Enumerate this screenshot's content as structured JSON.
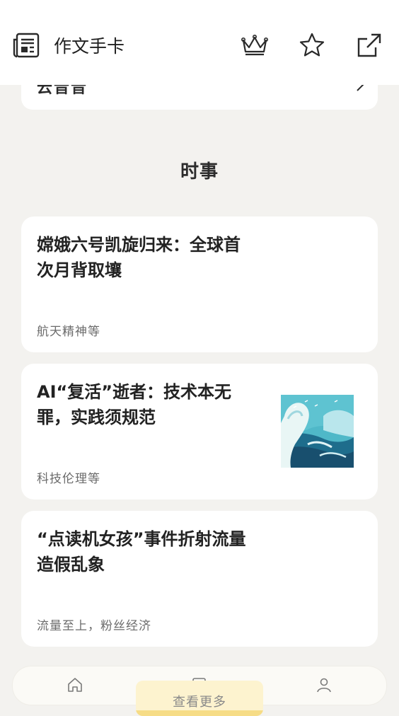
{
  "header": {
    "title": "作文手卡",
    "actions": [
      {
        "icon": "crown-icon"
      },
      {
        "icon": "star-icon"
      },
      {
        "icon": "share-icon"
      }
    ]
  },
  "previous_card": {
    "partial_text": "云音音"
  },
  "section": {
    "title": "时事"
  },
  "cards": [
    {
      "title": "嫦娥六号凯旋归来：全球首次月背取壤",
      "tag": "航天精神等",
      "has_image": false
    },
    {
      "title": "AI“复活”逝者：技术本无罪，实践须规范",
      "tag": "科技伦理等",
      "has_image": true,
      "image": "ocean-wave-illustration"
    },
    {
      "title": "“点读机女孩”事件折射流量造假乱象",
      "tag": "流量至上，粉丝经济",
      "has_image": false
    }
  ],
  "more_button": {
    "label": "查看更多"
  },
  "bottom_nav": {
    "items": [
      {
        "icon": "home-icon"
      },
      {
        "icon": "notes-icon"
      },
      {
        "icon": "profile-icon"
      }
    ]
  },
  "colors": {
    "background": "#f3f2ef",
    "card": "#ffffff",
    "more_button_bg": "#fdf3cf",
    "more_button_accent": "#f6dc86"
  }
}
